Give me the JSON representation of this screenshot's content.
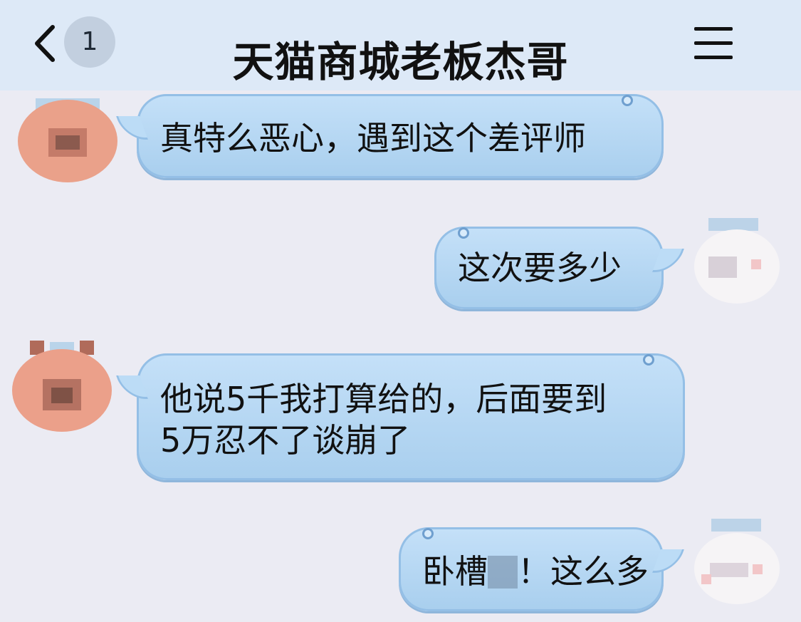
{
  "header": {
    "unread_count": "1",
    "title": "天猫商城老板杰哥"
  },
  "messages": [
    {
      "side": "left",
      "text": "真特么恶心，遇到这个差评师"
    },
    {
      "side": "right",
      "text": "这次要多少"
    },
    {
      "side": "left",
      "line1": "他说5千我打算给的，后面要到",
      "line2": "5万忍不了谈崩了"
    },
    {
      "side": "right",
      "text_a": "卧槽",
      "text_b": "！这么多"
    }
  ],
  "icons": {
    "back": "chevron-left-icon",
    "menu": "hamburger-menu-icon"
  },
  "colors": {
    "background": "#ebebf3",
    "header": "#dde9f7",
    "bubble": "#b8d9f4"
  }
}
